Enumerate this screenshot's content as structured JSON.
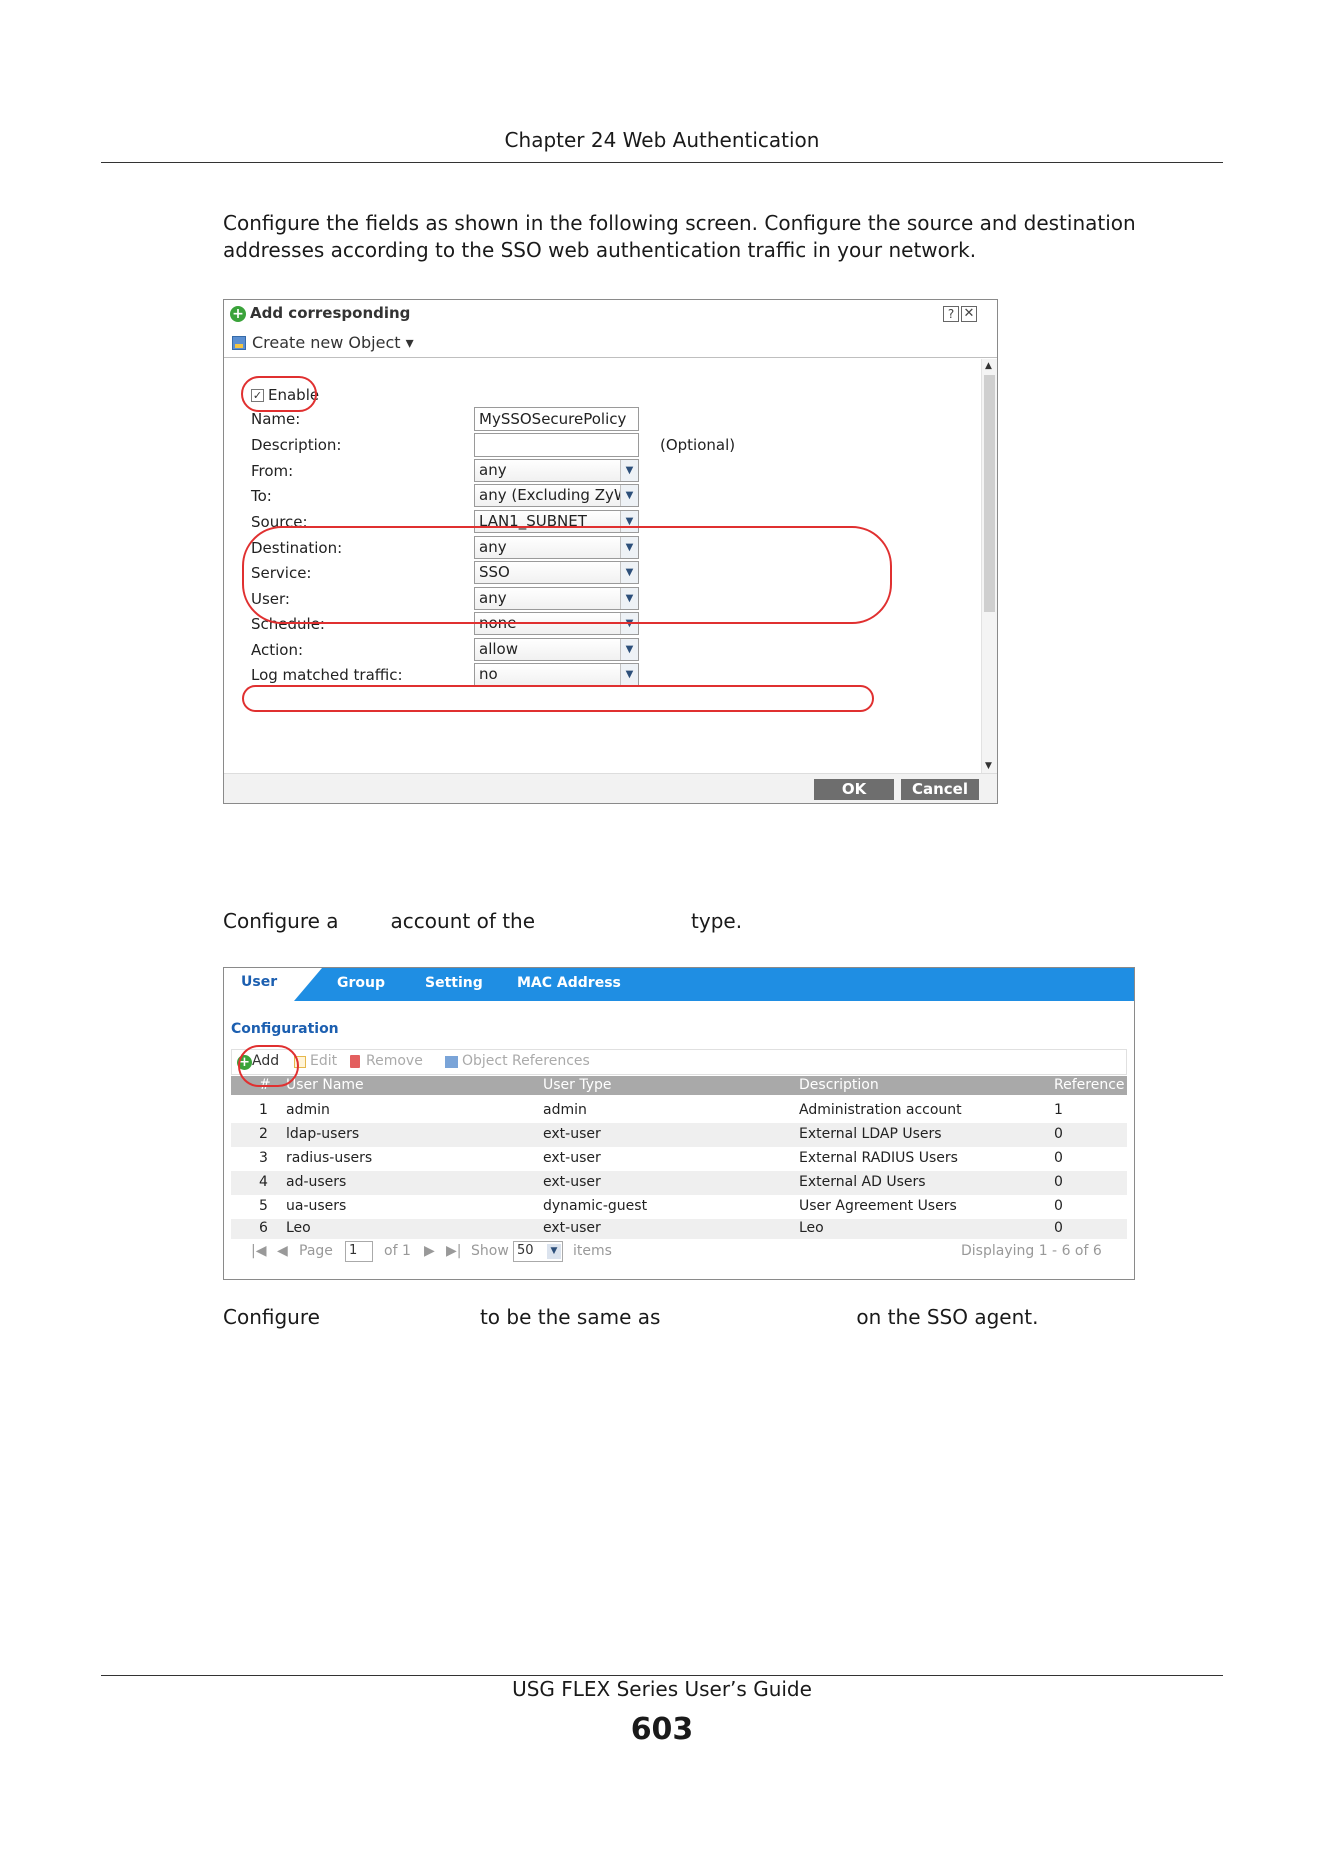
{
  "header": {
    "title": "Chapter 24 Web Authentication"
  },
  "paragraphs": {
    "p1": "Configure the fields as shown in the following screen. Configure the source and destination addresses according to the SSO web authentication traffic in your network.",
    "p2_a": "Configure a",
    "p2_b": "account of the",
    "p2_c": "type.",
    "p3_a": "Configure",
    "p3_b": "to be the same as",
    "p3_c": "on the SSO agent."
  },
  "dialog": {
    "title": "Add corresponding",
    "toolbar_label": "Create new Object ▾",
    "help": "?",
    "close": "✕",
    "enable_label": "Enable",
    "enable_checked": "✓",
    "fields": {
      "name": {
        "label": "Name:",
        "value": "MySSOSecurePolicy"
      },
      "description": {
        "label": "Description:",
        "value": "",
        "hint": "(Optional)"
      },
      "from": {
        "label": "From:",
        "value": "any"
      },
      "to": {
        "label": "To:",
        "value": "any (Excluding ZyW"
      },
      "source": {
        "label": "Source:",
        "value": "LAN1_SUBNET"
      },
      "destination": {
        "label": "Destination:",
        "value": "any"
      },
      "service": {
        "label": "Service:",
        "value": "SSO"
      },
      "user": {
        "label": "User:",
        "value": "any"
      },
      "schedule": {
        "label": "Schedule:",
        "value": "none"
      },
      "action": {
        "label": "Action:",
        "value": "allow"
      },
      "log": {
        "label": "Log matched traffic:",
        "value": "no"
      }
    },
    "ok": "OK",
    "cancel": "Cancel"
  },
  "panel": {
    "tabs": [
      "User",
      "Group",
      "Setting",
      "MAC Address"
    ],
    "section_title": "Configuration",
    "toolbar": {
      "add": "Add",
      "edit": "Edit",
      "remove": "Remove",
      "object_references": "Object References"
    },
    "columns": [
      "#",
      "User Name",
      "User Type",
      "Description",
      "Reference"
    ],
    "rows": [
      [
        "1",
        "admin",
        "admin",
        "Administration account",
        "1"
      ],
      [
        "2",
        "ldap-users",
        "ext-user",
        "External LDAP Users",
        "0"
      ],
      [
        "3",
        "radius-users",
        "ext-user",
        "External RADIUS Users",
        "0"
      ],
      [
        "4",
        "ad-users",
        "ext-user",
        "External AD Users",
        "0"
      ],
      [
        "5",
        "ua-users",
        "dynamic-guest",
        "User Agreement Users",
        "0"
      ],
      [
        "6",
        "Leo",
        "ext-user",
        "Leo",
        "0"
      ]
    ],
    "pager": {
      "page_label": "Page",
      "page_value": "1",
      "of_label": "of 1",
      "show_label": "Show",
      "show_value": "50",
      "items_label": "items",
      "displaying": "Displaying 1 - 6 of 6"
    }
  },
  "footer": {
    "guide_title": "USG FLEX Series User’s Guide",
    "page_number": "603"
  },
  "colors": {
    "tab_bar": "#1f8ee3",
    "highlight_circle": "#e03030",
    "add_icon": "#3aa33a"
  }
}
